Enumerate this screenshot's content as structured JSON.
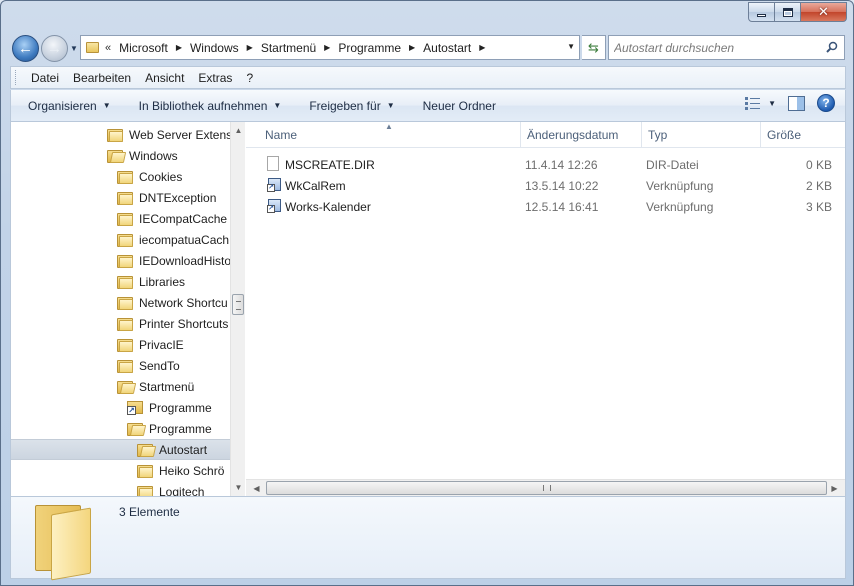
{
  "window": {
    "caption_buttons": {
      "minimize_icon": "minimize-icon",
      "maximize_icon": "maximize-icon",
      "close_icon": "close-icon"
    }
  },
  "address_bar": {
    "overflow_glyph": "«",
    "crumbs": [
      "Microsoft",
      "Windows",
      "Startmenü",
      "Programme",
      "Autostart"
    ]
  },
  "search": {
    "placeholder": "Autostart durchsuchen"
  },
  "menubar": {
    "items": [
      "Datei",
      "Bearbeiten",
      "Ansicht",
      "Extras",
      "?"
    ]
  },
  "commandbar": {
    "items": [
      {
        "label": "Organisieren",
        "has_dropdown": true
      },
      {
        "label": "In Bibliothek aufnehmen",
        "has_dropdown": true
      },
      {
        "label": "Freigeben für",
        "has_dropdown": true
      },
      {
        "label": "Neuer Ordner",
        "has_dropdown": false
      }
    ]
  },
  "nav_tree": {
    "items": [
      {
        "label": "Web Server Extens",
        "icon": "folder-icon"
      },
      {
        "label": "Windows",
        "icon": "folder-open-icon"
      },
      {
        "label": "Cookies",
        "icon": "folder-icon"
      },
      {
        "label": "DNTException",
        "icon": "folder-icon"
      },
      {
        "label": "IECompatCache",
        "icon": "folder-icon"
      },
      {
        "label": "iecompatuaCach",
        "icon": "folder-icon"
      },
      {
        "label": "IEDownloadHisto",
        "icon": "folder-icon"
      },
      {
        "label": "Libraries",
        "icon": "folder-icon"
      },
      {
        "label": "Network Shortcu",
        "icon": "folder-icon"
      },
      {
        "label": "Printer Shortcuts",
        "icon": "folder-icon"
      },
      {
        "label": "PrivacIE",
        "icon": "folder-icon"
      },
      {
        "label": "SendTo",
        "icon": "folder-icon"
      },
      {
        "label": "Startmenü",
        "icon": "folder-open-icon"
      },
      {
        "label": "Programme",
        "icon": "shortcut-folder-icon"
      },
      {
        "label": "Programme",
        "icon": "folder-open-icon"
      },
      {
        "label": "Autostart",
        "icon": "folder-open-icon",
        "selected": true
      },
      {
        "label": "Heiko Schrö",
        "icon": "folder-icon"
      },
      {
        "label": "Logitech",
        "icon": "folder-icon"
      }
    ]
  },
  "file_list": {
    "columns": [
      "Name",
      "Änderungsdatum",
      "Typ",
      "Größe"
    ],
    "rows": [
      {
        "name": "MSCREATE.DIR",
        "date": "11.4.14 12:26",
        "type": "DIR-Datei",
        "size": "0 KB",
        "icon": "document-icon"
      },
      {
        "name": "WkCalRem",
        "date": "13.5.14 10:22",
        "type": "Verknüpfung",
        "size": "2 KB",
        "icon": "shortcut-icon"
      },
      {
        "name": "Works-Kalender",
        "date": "12.5.14 16:41",
        "type": "Verknüpfung",
        "size": "3 KB",
        "icon": "shortcut-icon"
      }
    ]
  },
  "details": {
    "count_text": "3 Elemente"
  },
  "colors": {
    "window_frame": "#c2d3e8",
    "selection": "#ccd5e0",
    "close_button": "#c2452b"
  }
}
